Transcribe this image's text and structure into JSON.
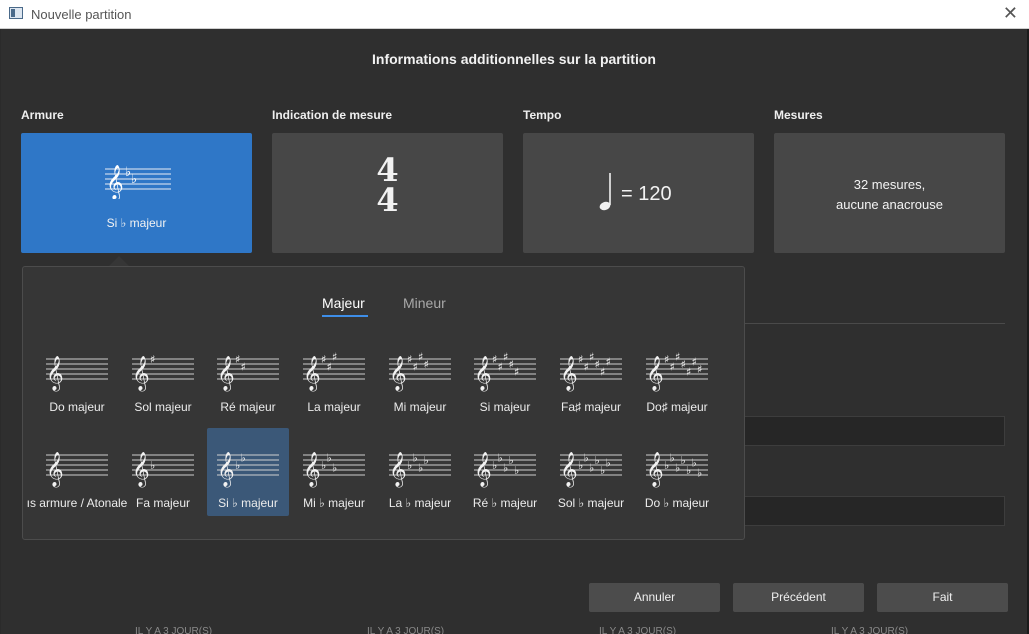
{
  "window": {
    "title": "Nouvelle partition"
  },
  "dialog": {
    "heading": "Informations additionnelles sur la partition"
  },
  "sections": {
    "key": {
      "label": "Armure",
      "value": "Si ♭ majeur"
    },
    "time": {
      "label": "Indication de mesure",
      "numerator": "4",
      "denominator": "4"
    },
    "tempo": {
      "label": "Tempo",
      "text": "= 120",
      "note_icon": "quarter-note-icon"
    },
    "measures": {
      "label": "Mesures",
      "line1": "32 mesures,",
      "line2": "aucune anacrouse"
    }
  },
  "popup": {
    "tabs": [
      {
        "label": "Majeur",
        "selected": true
      },
      {
        "label": "Mineur",
        "selected": false
      }
    ],
    "rows": [
      [
        {
          "label": "Do majeur",
          "sharps": 0,
          "flats": 0
        },
        {
          "label": "Sol majeur",
          "sharps": 1,
          "flats": 0
        },
        {
          "label": "Ré majeur",
          "sharps": 2,
          "flats": 0
        },
        {
          "label": "La majeur",
          "sharps": 3,
          "flats": 0
        },
        {
          "label": "Mi majeur",
          "sharps": 4,
          "flats": 0
        },
        {
          "label": "Si majeur",
          "sharps": 5,
          "flats": 0
        },
        {
          "label": "Fa♯ majeur",
          "sharps": 6,
          "flats": 0
        },
        {
          "label": "Do♯ majeur",
          "sharps": 7,
          "flats": 0
        }
      ],
      [
        {
          "label": "ıs armure / Atonale",
          "sharps": 0,
          "flats": 0
        },
        {
          "label": "Fa majeur",
          "sharps": 0,
          "flats": 1
        },
        {
          "label": "Si ♭ majeur",
          "sharps": 0,
          "flats": 2,
          "selected": true
        },
        {
          "label": "Mi ♭ majeur",
          "sharps": 0,
          "flats": 3
        },
        {
          "label": "La ♭ majeur",
          "sharps": 0,
          "flats": 4
        },
        {
          "label": "Ré ♭ majeur",
          "sharps": 0,
          "flats": 5
        },
        {
          "label": "Sol ♭ majeur",
          "sharps": 0,
          "flats": 6
        },
        {
          "label": "Do ♭ majeur",
          "sharps": 0,
          "flats": 7
        }
      ]
    ]
  },
  "buttons": {
    "cancel": "Annuler",
    "previous": "Précédent",
    "done": "Fait"
  },
  "footer": {
    "items": [
      "IL Y A 3 JOUR(S)",
      "IL Y A 3 JOUR(S)",
      "IL Y A 3 JOUR(S)",
      "IL Y A 3 JOUR(S)"
    ]
  },
  "colors": {
    "accent": "#2f77c7",
    "tab_underline": "#3e8ee8",
    "selected_key": "#3b5878"
  }
}
